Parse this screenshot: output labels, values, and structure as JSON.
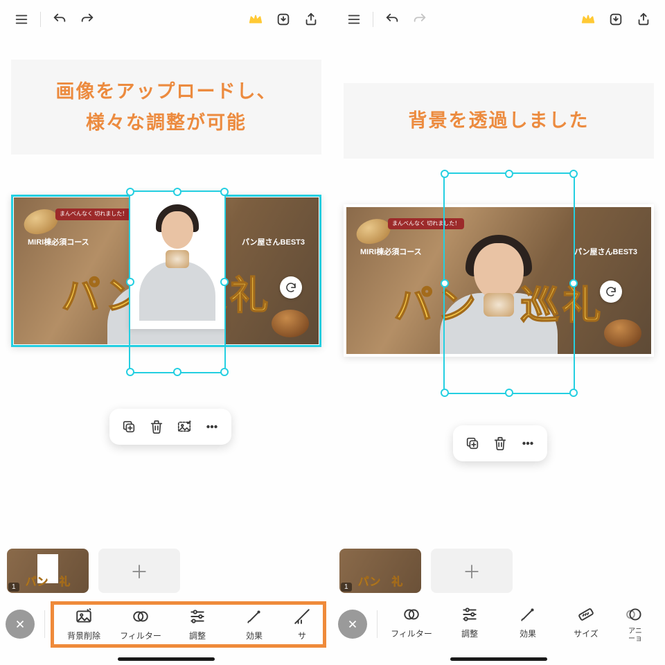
{
  "left": {
    "caption_line1": "画像をアップロードし、",
    "caption_line2": "様々な調整が可能",
    "canvas": {
      "big_text": "パン　巡礼",
      "small_left": "MIRI棟必須コース",
      "small_right": "パン屋さんBEST3",
      "badge": "まんべんなく\\n切れました！"
    },
    "float_tools": [
      "duplicate",
      "trash",
      "replace-image",
      "more"
    ],
    "page_thumb": {
      "number": "1",
      "big_text": "パン　礼"
    },
    "bottom_tools": [
      {
        "key": "bg-remove",
        "label": "背景削除"
      },
      {
        "key": "filter",
        "label": "フィルター"
      },
      {
        "key": "adjust",
        "label": "調整"
      },
      {
        "key": "effect",
        "label": "効果"
      },
      {
        "key": "size-cut",
        "label": "サ"
      }
    ]
  },
  "right": {
    "caption_line1": "背景を透過しました",
    "canvas": {
      "big_text": "パン　巡礼",
      "small_left": "MIRI棟必須コース",
      "small_right": "パン屋さんBEST3",
      "badge": "まんべんなく\\n切れました！"
    },
    "float_tools": [
      "duplicate",
      "trash",
      "more"
    ],
    "page_thumb": {
      "number": "1",
      "big_text": "パン　礼"
    },
    "bottom_tools": [
      {
        "key": "filter",
        "label": "フィルター"
      },
      {
        "key": "adjust",
        "label": "調整"
      },
      {
        "key": "effect",
        "label": "効果"
      },
      {
        "key": "size",
        "label": "サイズ"
      },
      {
        "key": "animation",
        "label": "アニメーション"
      }
    ]
  },
  "colors": {
    "accent": "#24cfe1",
    "highlight": "#ef8a3a",
    "caption": "#ec8b3f"
  }
}
